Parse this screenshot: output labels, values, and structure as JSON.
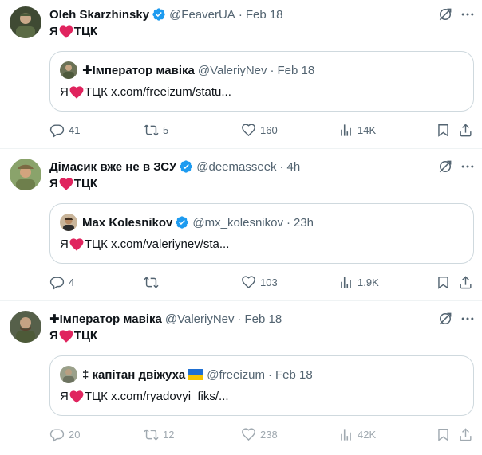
{
  "colors": {
    "accent": "#1d9bf0",
    "text": "#0f1419",
    "muted": "#536471",
    "border": "#cfd9de",
    "heart": "#f91880"
  },
  "tweets": [
    {
      "name": "Oleh Skarzhinsky",
      "handle": "@FeaverUA",
      "dot": "·",
      "time": "Feb 18",
      "text_before": "Я",
      "text_after": "ТЦК",
      "quote": {
        "name": "✚Імператор мавіка",
        "handle": "@ValeriyNev",
        "dot": "·",
        "time": "Feb 18",
        "text_before": "Я",
        "text_after": "ТЦК x.com/freeizum/statu..."
      },
      "replies": "41",
      "retweets": "5",
      "likes": "160",
      "views": "14K"
    },
    {
      "name": "Дімасик вже не в ЗСУ",
      "handle": "@deemasseek",
      "dot": "·",
      "time": "4h",
      "text_before": "Я",
      "text_after": "ТЦК",
      "quote": {
        "name": "Max Kolesnikov",
        "handle": "@mx_kolesnikov",
        "dot": "·",
        "time": "23h",
        "text_before": "Я",
        "text_after": "ТЦК x.com/valeriynev/sta..."
      },
      "replies": "4",
      "retweets": "",
      "likes": "103",
      "views": "1.9K"
    },
    {
      "name": "✚Імператор мавіка",
      "handle": "@ValeriyNev",
      "dot": "·",
      "time": "Feb 18",
      "text_before": "Я",
      "text_after": "ТЦК",
      "quote": {
        "name": "‡ капітан двіжуха",
        "handle": "@freeizum",
        "dot": "·",
        "time": "Feb 18",
        "text_before": "Я",
        "text_after": "ТЦК x.com/ryadovyi_fiks/..."
      },
      "replies": "20",
      "retweets": "12",
      "likes": "238",
      "views": "42K"
    }
  ]
}
